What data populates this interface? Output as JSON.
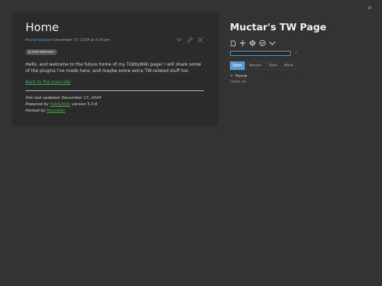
{
  "top_toggle": "»",
  "tiddler": {
    "title": "Home",
    "author": "Muctar Dawson",
    "date": "December 17, 2024 at 3:14 pm",
    "tag": "$:/md-tw/main",
    "body": "Hello, and welcome to the future home of my TiddlyWiki page! I will share some of the plugins I've made here, and maybe some extra TW-related stuff too.",
    "back_link": "Back to the main site",
    "last_updated": "Site last updated: December 17, 2024",
    "powered_prefix": "Powered by",
    "powered_link": "TiddlyWiki",
    "powered_suffix": "version 5.3.6",
    "hosted_prefix": "Hosted by",
    "hosted_link": "Neocities"
  },
  "sidebar": {
    "site_title": "Muctar's TW Page",
    "search": {
      "value": "",
      "placeholder": ""
    },
    "tabs": [
      {
        "label": "Open",
        "active": true
      },
      {
        "label": "Recent",
        "active": false
      },
      {
        "label": "Tools",
        "active": false
      },
      {
        "label": "More",
        "active": false
      }
    ],
    "open_items": [
      {
        "label": "Home"
      }
    ],
    "close_all": "close all"
  },
  "icons": {
    "tiddler_controls": [
      "chevron-down-icon",
      "edit-icon",
      "close-icon"
    ],
    "page_controls": [
      "new-tiddler-icon",
      "plus-icon",
      "gear-icon",
      "check-circle-icon",
      "chevron-down-icon"
    ],
    "search": "search-icon"
  },
  "colors": {
    "background": "#333333",
    "tiddler_bg": "#2b2b2b",
    "accent": "#5b9bd5",
    "link": "#4caf50"
  }
}
